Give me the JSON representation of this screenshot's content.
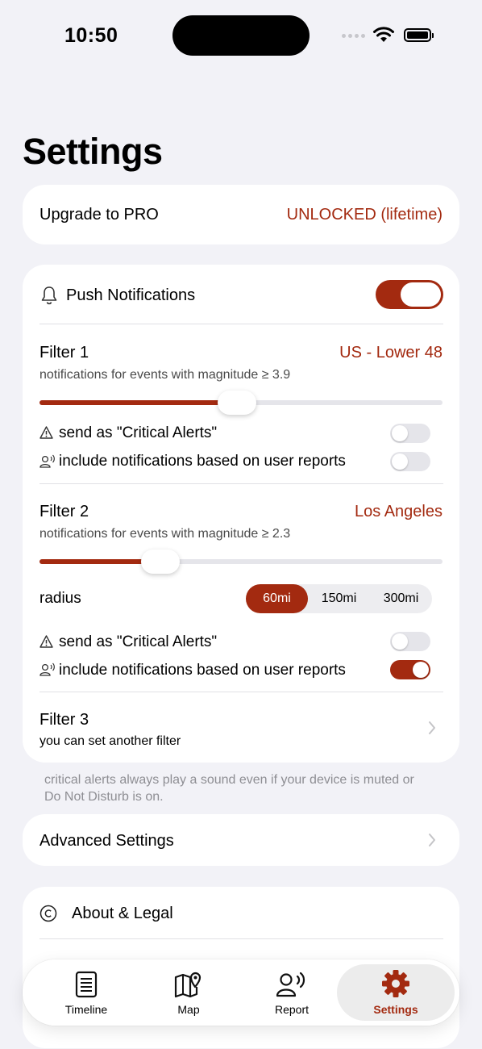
{
  "status": {
    "time": "10:50"
  },
  "page": {
    "title": "Settings"
  },
  "upgrade": {
    "label": "Upgrade to PRO",
    "value": "UNLOCKED (lifetime)"
  },
  "push": {
    "label": "Push Notifications",
    "enabled": true
  },
  "filter1": {
    "title": "Filter 1",
    "region": "US - Lower 48",
    "description": "notifications for events with magnitude ≥ 3.9",
    "slider_fraction": 0.49,
    "critical_label": "send as \"Critical Alerts\"",
    "critical_on": false,
    "user_reports_label": "include notifications based on user reports",
    "user_reports_on": false
  },
  "filter2": {
    "title": "Filter 2",
    "region": "Los Angeles",
    "description": "notifications for events with magnitude ≥ 2.3",
    "slider_fraction": 0.3,
    "radius_label": "radius",
    "radius_options": [
      "60mi",
      "150mi",
      "300mi"
    ],
    "radius_selected": "60mi",
    "critical_label": "send as \"Critical Alerts\"",
    "critical_on": false,
    "user_reports_label": "include notifications based on user reports",
    "user_reports_on": true
  },
  "filter3": {
    "title": "Filter 3",
    "subtitle": "you can set another filter"
  },
  "footnote": "critical alerts always play a sound even if your device is muted or Do Not Disturb is on.",
  "advanced": {
    "label": "Advanced Settings"
  },
  "about": {
    "label": "About & Legal"
  },
  "tabs": [
    {
      "label": "Timeline",
      "icon": "timeline-icon"
    },
    {
      "label": "Map",
      "icon": "map-pin-icon"
    },
    {
      "label": "Report",
      "icon": "person-wave-icon"
    },
    {
      "label": "Settings",
      "icon": "gear-icon",
      "active": true
    }
  ],
  "colors": {
    "accent": "#A32A10",
    "background": "#F2F2F7"
  }
}
